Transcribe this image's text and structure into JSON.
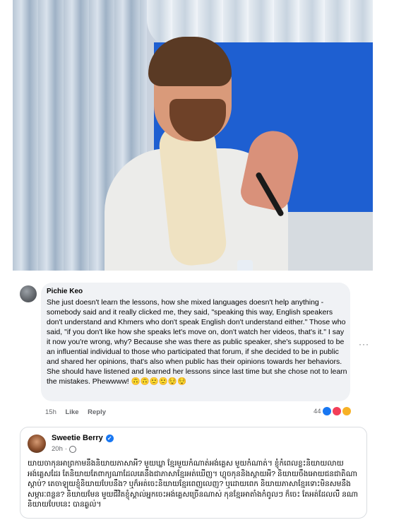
{
  "comment1": {
    "author": "Pichie Keo",
    "text": "She just doesn't learn the lessons, how she mixed languages doesn't help anything - somebody said and it really clicked me, they said, \"speaking this way, English speakers don't understand and Khmers who don't speak English don't understand either.\" Those who said, \"if you don't like how she speaks let's move on, don't watch her videos, that's it.\" I say it now you're wrong, why? Because she was there as public speaker, she's supposed to be an influential individual to those who participated that forum, if she decided to be in public and shared her opinions, that's also when public has their opinions towards her behaviors. She should have listened and learned her lessons since last time but she chose not to learn the mistakes. Phewwww! 🙃🙃🙂🙂😌😌",
    "time": "15h",
    "like_label": "Like",
    "reply_label": "Reply",
    "reaction_count": "44",
    "more_glyph": "···"
  },
  "comment2": {
    "author": "Sweetie Berry",
    "verified_glyph": "✓",
    "time": "20h",
    "separator": "·",
    "text": "យាយចាកុនអាព្រកាមនឹងនិយាយភាសាអី? មួយឃ្លា ខ្មែរមួយកំណាត់អង់គ្លេស មួយកំណាត់។ ខ្ញុំកំពេលខ្លះនិយាយលាយអង់គ្លេសដែរ តែនិយាយតែពាក្យណាដែលគេនឹងជាភាសាខ្មែរអត់ឃើញ។ ហ្ហុចកុននិងស្តាយអី? និយាយចឹងអោយជនជាតិណាស្តាប់? តេចាឡុយខ្ញុំនិយាយបែបនឹង? ឬក៏អត់ចេះនិយាយខ្មែរពេញលេញ? ឬដោយពេក និយាយភាសាខ្មែរទោះមិនសមនឹងសម្ភារៈពន្លន? និយាយមែន មួយជីវិតខ្ញុំស្គាល់អ្នកចេះអង់គ្លេសច្រើនណាស់ កុនខ្មែរអាតាំងកំពូលៗ ក៏ចេះ តែអត់ដែលលឺ នណានិយាយបែបនេះ បានឆ្ងល់។"
  },
  "colors": {
    "accent": "#1877f2",
    "bubble_bg": "#f0f2f5",
    "muted_text": "#65676b"
  }
}
